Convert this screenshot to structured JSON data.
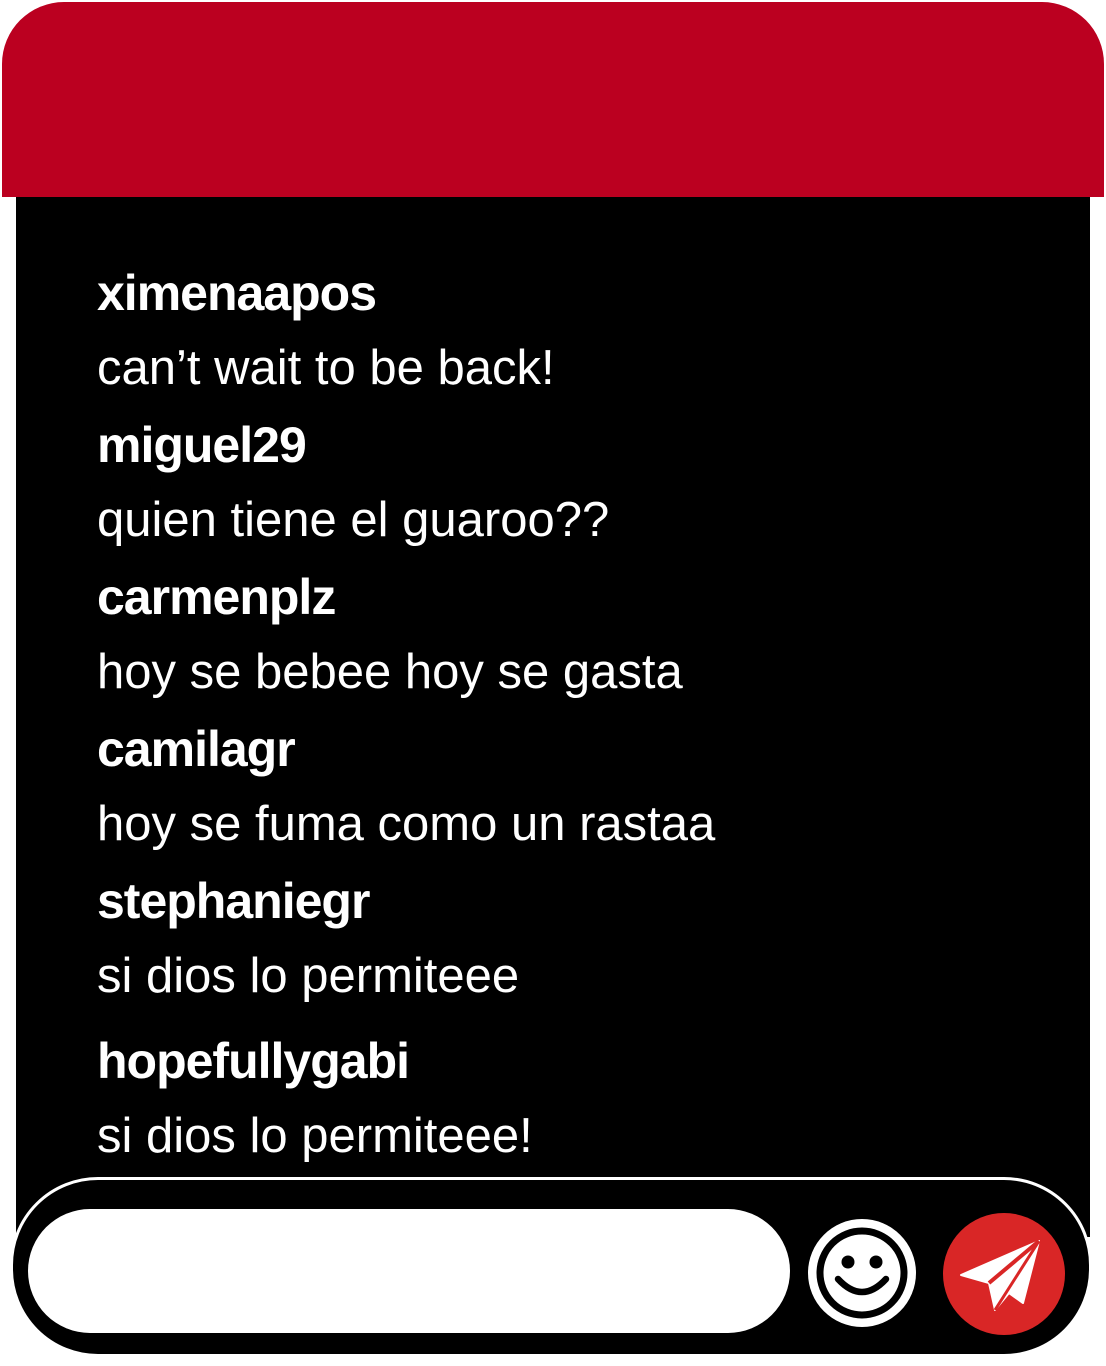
{
  "colors": {
    "header": "#bb0020",
    "panel": "#000000",
    "send_button": "#d92626",
    "text": "#ffffff"
  },
  "messages": [
    {
      "username": "ximenaapos",
      "text": "can’t wait to be back!"
    },
    {
      "username": "miguel29",
      "text": "quien tiene el guaroo??"
    },
    {
      "username": "carmenplz",
      "text": "hoy se bebee hoy se gasta"
    },
    {
      "username": "camilagr",
      "text": "hoy se fuma como un rastaa"
    },
    {
      "username": "stephaniegr",
      "text": "si dios lo permiteee"
    },
    {
      "username": "hopefullygabi",
      "text": "si dios lo permiteee!"
    }
  ],
  "composer": {
    "input_value": "",
    "emoji_icon": "smiley-face-icon",
    "send_icon": "paper-plane-icon"
  }
}
